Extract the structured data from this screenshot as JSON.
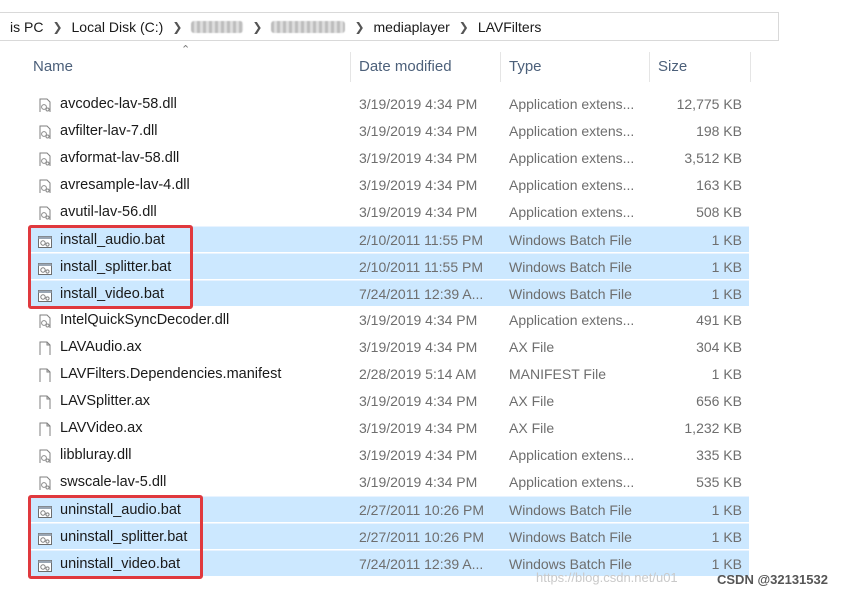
{
  "breadcrumb": {
    "items": [
      "is PC",
      "Local Disk (C:)",
      "",
      "",
      "mediaplayer",
      "LAVFilters"
    ]
  },
  "columns": {
    "name": "Name",
    "date": "Date modified",
    "type": "Type",
    "size": "Size"
  },
  "files": [
    {
      "name": "avcodec-lav-58.dll",
      "date": "3/19/2019 4:34 PM",
      "type": "Application extens...",
      "size": "12,775 KB",
      "icon": "dll-file-icon",
      "selected": false
    },
    {
      "name": "avfilter-lav-7.dll",
      "date": "3/19/2019 4:34 PM",
      "type": "Application extens...",
      "size": "198 KB",
      "icon": "dll-file-icon",
      "selected": false
    },
    {
      "name": "avformat-lav-58.dll",
      "date": "3/19/2019 4:34 PM",
      "type": "Application extens...",
      "size": "3,512 KB",
      "icon": "dll-file-icon",
      "selected": false
    },
    {
      "name": "avresample-lav-4.dll",
      "date": "3/19/2019 4:34 PM",
      "type": "Application extens...",
      "size": "163 KB",
      "icon": "dll-file-icon",
      "selected": false
    },
    {
      "name": "avutil-lav-56.dll",
      "date": "3/19/2019 4:34 PM",
      "type": "Application extens...",
      "size": "508 KB",
      "icon": "dll-file-icon",
      "selected": false
    },
    {
      "name": "install_audio.bat",
      "date": "2/10/2011 11:55 PM",
      "type": "Windows Batch File",
      "size": "1 KB",
      "icon": "batch-file-icon",
      "selected": true
    },
    {
      "name": "install_splitter.bat",
      "date": "2/10/2011 11:55 PM",
      "type": "Windows Batch File",
      "size": "1 KB",
      "icon": "batch-file-icon",
      "selected": true
    },
    {
      "name": "install_video.bat",
      "date": "7/24/2011 12:39 A...",
      "type": "Windows Batch File",
      "size": "1 KB",
      "icon": "batch-file-icon",
      "selected": true
    },
    {
      "name": "IntelQuickSyncDecoder.dll",
      "date": "3/19/2019 4:34 PM",
      "type": "Application extens...",
      "size": "491 KB",
      "icon": "dll-file-icon",
      "selected": false
    },
    {
      "name": "LAVAudio.ax",
      "date": "3/19/2019 4:34 PM",
      "type": "AX File",
      "size": "304 KB",
      "icon": "blank-file-icon",
      "selected": false
    },
    {
      "name": "LAVFilters.Dependencies.manifest",
      "date": "2/28/2019 5:14 AM",
      "type": "MANIFEST File",
      "size": "1 KB",
      "icon": "blank-file-icon",
      "selected": false
    },
    {
      "name": "LAVSplitter.ax",
      "date": "3/19/2019 4:34 PM",
      "type": "AX File",
      "size": "656 KB",
      "icon": "blank-file-icon",
      "selected": false
    },
    {
      "name": "LAVVideo.ax",
      "date": "3/19/2019 4:34 PM",
      "type": "AX File",
      "size": "1,232 KB",
      "icon": "blank-file-icon",
      "selected": false
    },
    {
      "name": "libbluray.dll",
      "date": "3/19/2019 4:34 PM",
      "type": "Application extens...",
      "size": "335 KB",
      "icon": "dll-file-icon",
      "selected": false
    },
    {
      "name": "swscale-lav-5.dll",
      "date": "3/19/2019 4:34 PM",
      "type": "Application extens...",
      "size": "535 KB",
      "icon": "dll-file-icon",
      "selected": false
    },
    {
      "name": "uninstall_audio.bat",
      "date": "2/27/2011 10:26 PM",
      "type": "Windows Batch File",
      "size": "1 KB",
      "icon": "batch-file-icon",
      "selected": true
    },
    {
      "name": "uninstall_splitter.bat",
      "date": "2/27/2011 10:26 PM",
      "type": "Windows Batch File",
      "size": "1 KB",
      "icon": "batch-file-icon",
      "selected": true
    },
    {
      "name": "uninstall_video.bat",
      "date": "7/24/2011 12:39 A...",
      "type": "Windows Batch File",
      "size": "1 KB",
      "icon": "batch-file-icon",
      "selected": true
    }
  ],
  "watermark": {
    "url": "https://blog.csdn.net/u01",
    "csdn": "CSDN @32131532"
  },
  "colors": {
    "selection": "#cce8ff",
    "highlight_box": "#e0393e",
    "header_text": "#4c607a"
  }
}
